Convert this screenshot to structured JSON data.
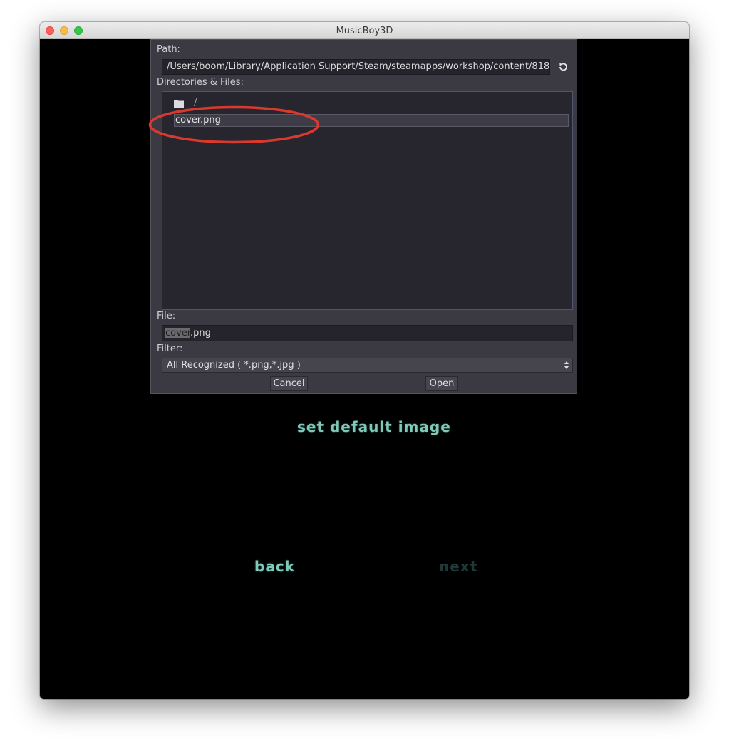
{
  "window": {
    "title": "MusicBoy3D"
  },
  "dialog": {
    "path_label": "Path:",
    "path_value": "/Users/boom/Library/Application Support/Steam/steamapps/workshop/content/818",
    "dirs_label": "Directories & Files:",
    "tree": {
      "root_label": "/",
      "files": [
        "cover.png"
      ]
    },
    "file_label": "File:",
    "file_value_selected": "cover",
    "file_value_rest": ".png",
    "filter_label": "Filter:",
    "filter_value": "All Recognized ( *.png,*.jpg )",
    "cancel_label": "Cancel",
    "open_label": "Open"
  },
  "game": {
    "set_default_label": "set default image",
    "back_label": "back",
    "next_label": "next"
  },
  "colors": {
    "annotation": "#d83a2f",
    "menu_text": "#7fc9b8",
    "menu_text_disabled": "#1f3a36"
  }
}
